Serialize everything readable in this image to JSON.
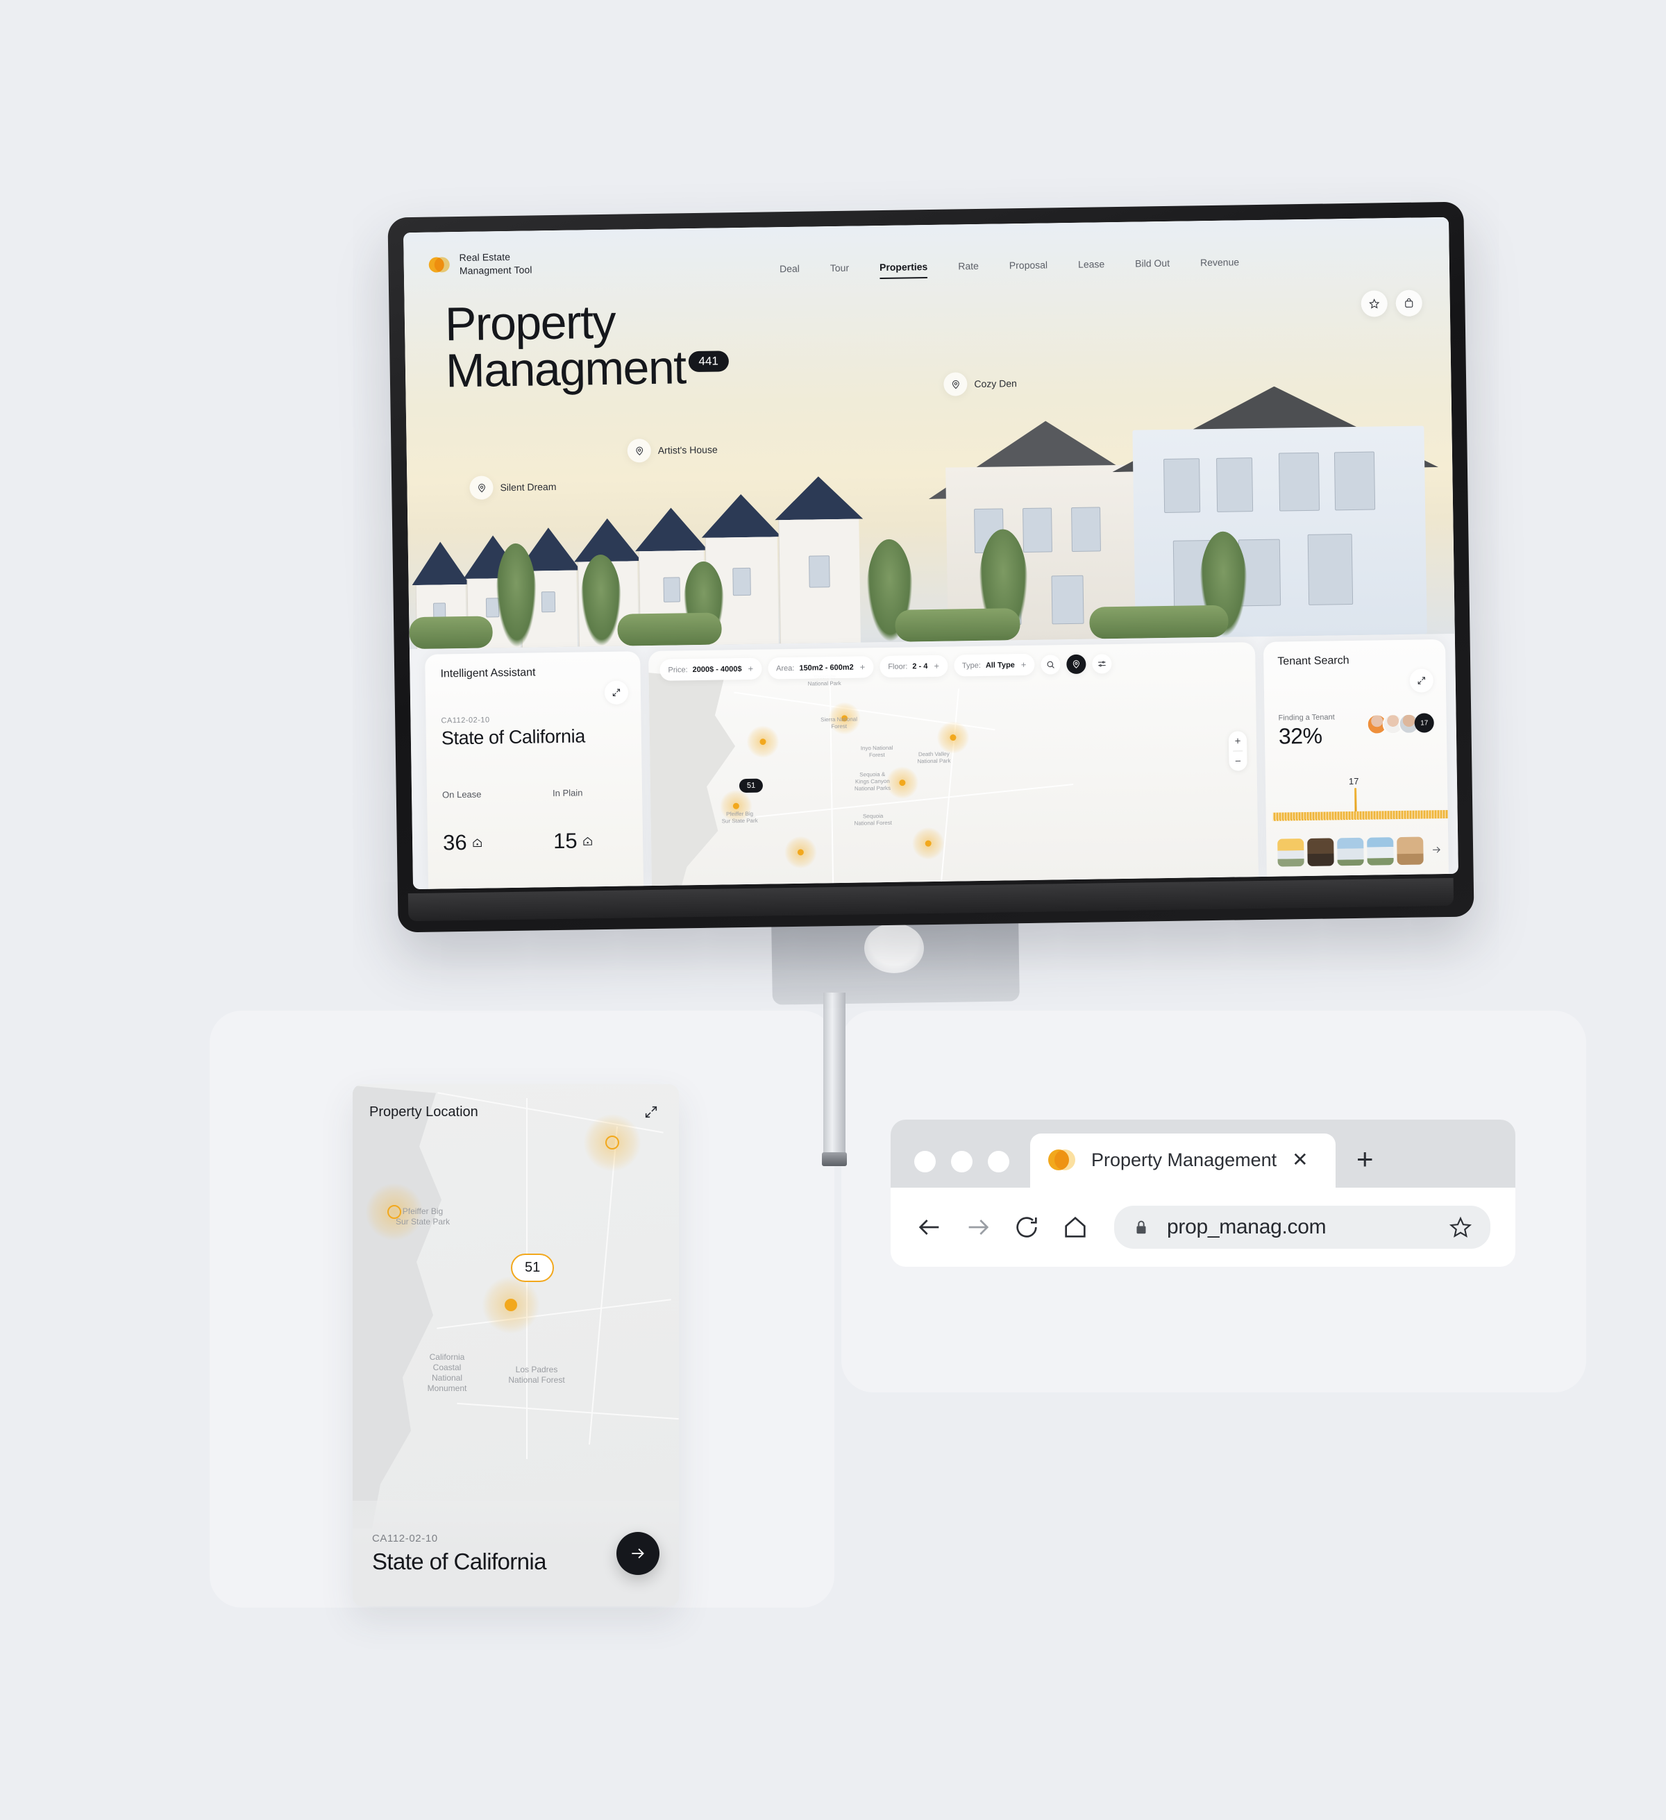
{
  "brand": {
    "logo": "logo-mark",
    "line1": "Real Estate",
    "line2": "Managment Tool"
  },
  "nav": [
    {
      "label": "Deal",
      "active": false
    },
    {
      "label": "Tour",
      "active": false
    },
    {
      "label": "Properties",
      "active": true
    },
    {
      "label": "Rate",
      "active": false
    },
    {
      "label": "Proposal",
      "active": false
    },
    {
      "label": "Lease",
      "active": false
    },
    {
      "label": "Bild Out",
      "active": false
    },
    {
      "label": "Revenue",
      "active": false
    }
  ],
  "hero": {
    "title_line1": "Property",
    "title_line2": "Managment",
    "badge_count": "441",
    "actions": [
      {
        "name": "favorite-button",
        "icon": "star-icon"
      },
      {
        "name": "saved-button",
        "icon": "bag-icon"
      }
    ],
    "pins": [
      {
        "label": "Silent Dream",
        "icon": "map-pin-icon"
      },
      {
        "label": "Artist's House",
        "icon": "map-pin-icon"
      },
      {
        "label": "Cozy Den",
        "icon": "map-pin-icon"
      }
    ]
  },
  "assistant": {
    "title": "Intelligent Assistant",
    "expand_icon": "expand-icon",
    "code": "CA112-02-10",
    "name": "State of California",
    "stats": [
      {
        "label": "On Lease",
        "value": "36",
        "icon": "house-icon"
      },
      {
        "label": "In Plain",
        "value": "15",
        "icon": "house-icon"
      }
    ]
  },
  "filters": {
    "chips": [
      {
        "key": "Price:",
        "value": "2000$ - 4000$",
        "plus": "+"
      },
      {
        "key": "Area:",
        "value": "150m2 - 600m2",
        "plus": "+"
      },
      {
        "key": "Floor:",
        "value": "2 - 4",
        "plus": "+"
      },
      {
        "key": "Type:",
        "value": "All Type",
        "plus": "+"
      }
    ],
    "buttons": [
      {
        "name": "search-button",
        "icon": "search-icon"
      },
      {
        "name": "locate-button",
        "icon": "map-pin-icon"
      },
      {
        "name": "sort-button",
        "icon": "sliders-icon"
      }
    ]
  },
  "map": {
    "cluster_badge": "51",
    "zoom_in": "+",
    "zoom_out": "−",
    "labels": [
      "Yosemite\nNational Park",
      "Sierra National\nForest",
      "Inyo National\nForest",
      "Sequoia &\nKings Canyon\nNational Parks",
      "Sequoia\nNational Forest",
      "Death Valley\nNational Park",
      "Pfeiffer Big\nSur State Park",
      "Los Padres\nNational Forest"
    ]
  },
  "tenant": {
    "title": "Tenant Search",
    "expand_icon": "expand-icon",
    "subtitle": "Finding a Tenant",
    "percent": "32%",
    "avatar_badge": "17",
    "ruler_value": "17",
    "next_icon": "arrow-right-icon"
  },
  "property_location": {
    "title": "Property Location",
    "expand_icon": "expand-icon",
    "badge": "51",
    "code": "CA112-02-10",
    "name": "State of California",
    "go_icon": "arrow-right-icon",
    "labels": [
      "Pfeiffer Big\nSur State Park",
      "California\nCoastal\nNational\nMonument",
      "Los Padres\nNational Forest"
    ]
  },
  "browser": {
    "window_dots": 3,
    "tab": {
      "favicon": "logo-mark",
      "title": "Property Management",
      "close": "✕"
    },
    "new_tab": "+",
    "toolbar": {
      "back": "back-icon",
      "forward": "forward-icon",
      "reload": "reload-icon",
      "home": "home-icon",
      "lock": "lock-icon",
      "url": "prop_manag.com",
      "bookmark": "star-icon"
    }
  },
  "colors": {
    "accent": "#f2a81d",
    "dark": "#15171c",
    "page_bg": "#eceef2",
    "panel_bg": "#f2f3f6"
  }
}
